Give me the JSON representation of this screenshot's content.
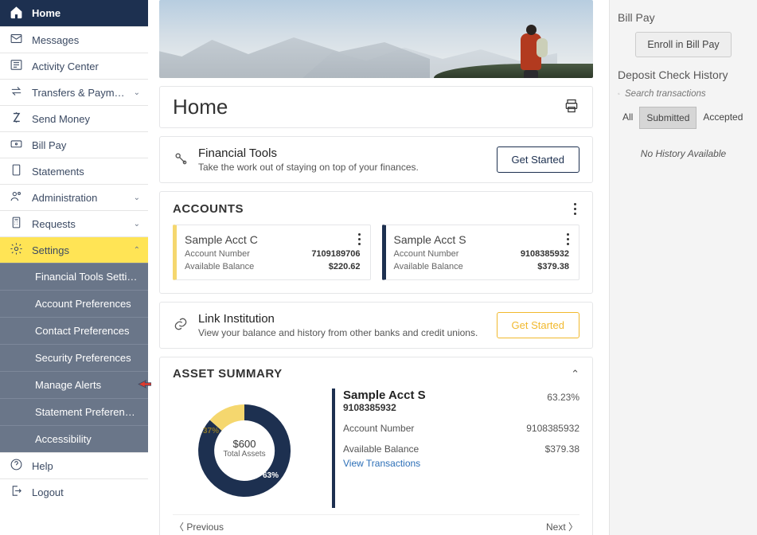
{
  "sidebar": {
    "items": [
      {
        "label": "Home",
        "icon": "home",
        "active": true
      },
      {
        "label": "Messages",
        "icon": "mail"
      },
      {
        "label": "Activity Center",
        "icon": "news"
      },
      {
        "label": "Transfers & Payments",
        "icon": "swap",
        "sub": true
      },
      {
        "label": "Send Money",
        "icon": "zelle"
      },
      {
        "label": "Bill Pay",
        "icon": "card"
      },
      {
        "label": "Statements",
        "icon": "doc"
      },
      {
        "label": "Administration",
        "icon": "admin",
        "sub": true
      },
      {
        "label": "Requests",
        "icon": "calc",
        "sub": true
      },
      {
        "label": "Settings",
        "icon": "gear",
        "sub": true,
        "open": true,
        "hl": true
      }
    ],
    "settings_children": [
      {
        "label": "Financial Tools Settings"
      },
      {
        "label": "Account Preferences"
      },
      {
        "label": "Contact Preferences"
      },
      {
        "label": "Security Preferences"
      },
      {
        "label": "Manage Alerts",
        "pointer": true
      },
      {
        "label": "Statement Preferences"
      },
      {
        "label": "Accessibility"
      }
    ],
    "footer": [
      {
        "label": "Help",
        "icon": "help"
      },
      {
        "label": "Logout",
        "icon": "logout"
      }
    ]
  },
  "page_title": "Home",
  "financial_tools": {
    "title": "Financial Tools",
    "subtitle": "Take the work out of staying on top of your finances.",
    "button": "Get Started"
  },
  "accounts": {
    "heading": "ACCOUNTS",
    "list": [
      {
        "name": "Sample Acct C",
        "number_label": "Account Number",
        "number": "7109189706",
        "balance_label": "Available Balance",
        "balance": "$220.62",
        "color": "gold"
      },
      {
        "name": "Sample Acct S",
        "number_label": "Account Number",
        "number": "9108385932",
        "balance_label": "Available Balance",
        "balance": "$379.38",
        "color": "navy"
      }
    ]
  },
  "link_inst": {
    "title": "Link Institution",
    "subtitle": "View your balance and history from other banks and credit unions.",
    "button": "Get Started"
  },
  "asset_summary": {
    "heading": "ASSET SUMMARY",
    "total_value": "$600",
    "total_label": "Total Assets",
    "pct_a": "37%",
    "pct_b": "63%",
    "selected": {
      "name": "Sample Acct S",
      "number": "9108385932",
      "pct": "63.23%",
      "acc_label": "Account Number",
      "acc_val": "9108385932",
      "bal_label": "Available Balance",
      "bal_val": "$379.38",
      "link": "View Transactions"
    },
    "prev": "〈  Previous",
    "next": "Next  〉"
  },
  "chart_data": {
    "type": "pie",
    "title": "Asset Summary",
    "total": 600,
    "unit": "$",
    "series": [
      {
        "name": "Sample Acct C",
        "value": 220.62,
        "pct": 36.77,
        "color": "#f5d76e"
      },
      {
        "name": "Sample Acct S",
        "value": 379.38,
        "pct": 63.23,
        "color": "#1d3050"
      }
    ]
  },
  "right": {
    "billpay_title": "Bill Pay",
    "enroll": "Enroll in Bill Pay",
    "deposit_title": "Deposit Check History",
    "search_placeholder": "Search transactions",
    "tabs": {
      "all": "All",
      "submitted": "Submitted",
      "accepted": "Accepted"
    },
    "no_history": "No History Available"
  }
}
